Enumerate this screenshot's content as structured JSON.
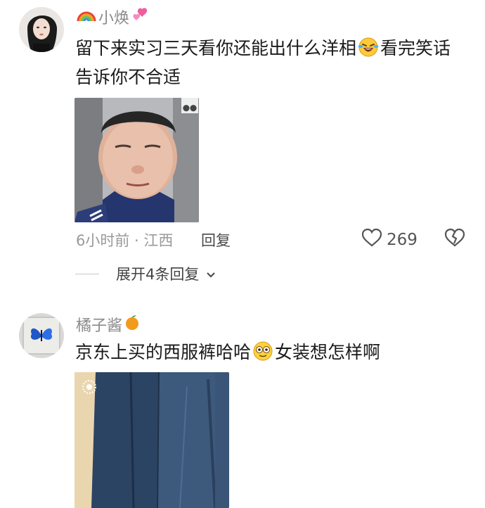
{
  "comments": [
    {
      "username": "小焕",
      "text_part1": "留下来实习三天看你还能出什么洋相",
      "text_part2": "看完笑话告诉你不合适",
      "time_location": "6小时前 · 江西",
      "reply_label": "回复",
      "like_count": "269",
      "expand_label": "展开4条回复"
    },
    {
      "username": "橘子酱",
      "text_part1": "京东上买的西服裤哈哈",
      "text_part2": "女装想怎样啊"
    }
  ],
  "colors": {
    "username": "#8a8a8a",
    "meta": "#9a9a9a",
    "text": "#1a1a1a"
  }
}
